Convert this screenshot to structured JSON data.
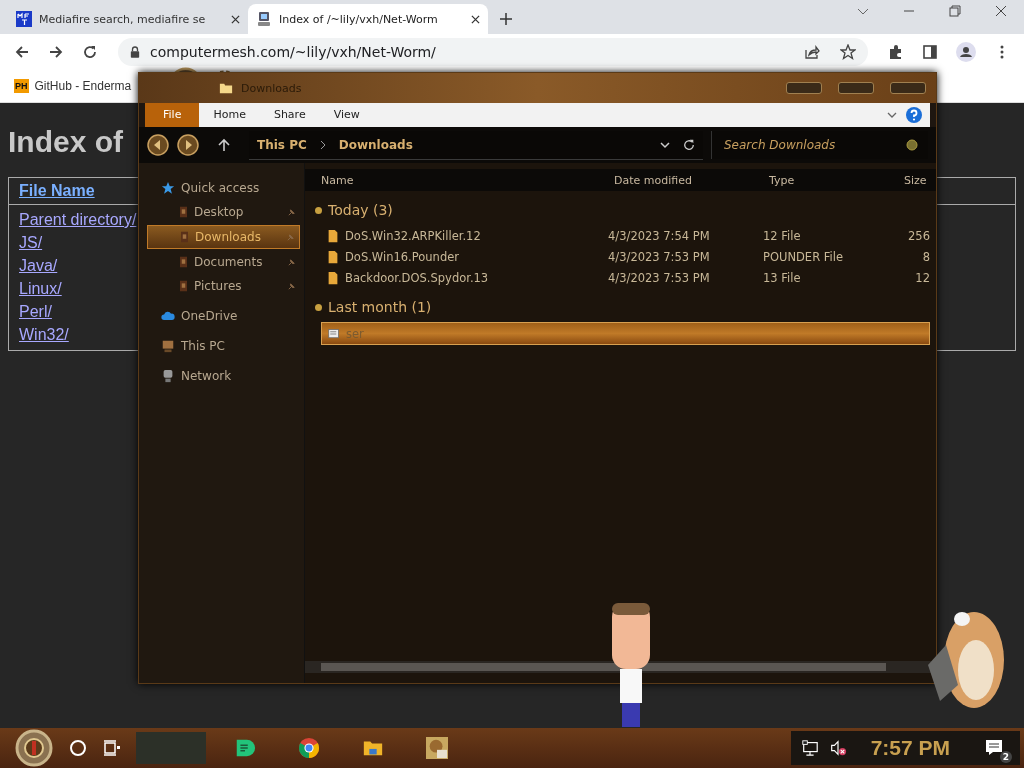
{
  "browser": {
    "tabs": [
      {
        "title": "Mediafire search, mediafire se",
        "kind": "letters",
        "selected": false
      },
      {
        "title": "Index of /~lily/vxh/Net-Worm",
        "kind": "computer",
        "selected": true
      }
    ],
    "url": "computermesh.com/~lily/vxh/Net-Worm/",
    "bookmarks": [
      {
        "badge": "PH",
        "label": "GitHub - Enderma"
      }
    ]
  },
  "page": {
    "heading": "Index of",
    "table": {
      "columns": [
        "File Name"
      ],
      "rows": [
        "Parent directory/",
        "JS/",
        "Java/",
        "Linux/",
        "Perl/",
        "Win32/"
      ]
    }
  },
  "explorer": {
    "title": "Downloads",
    "ribbon_tabs": [
      {
        "label": "File",
        "selected": true
      },
      {
        "label": "Home",
        "selected": false
      },
      {
        "label": "Share",
        "selected": false
      },
      {
        "label": "View",
        "selected": false
      }
    ],
    "breadcrumb": [
      "This PC",
      "Downloads"
    ],
    "search": {
      "placeholder": "Search Downloads"
    },
    "nav": [
      {
        "label": "Quick access",
        "kind": "star",
        "selected": false,
        "children": [
          {
            "label": "Desktop",
            "kind": "folder",
            "selected": false,
            "pinned": true
          },
          {
            "label": "Downloads",
            "kind": "folder",
            "selected": true,
            "pinned": true
          },
          {
            "label": "Documents",
            "kind": "folder",
            "selected": false,
            "pinned": true
          },
          {
            "label": "Pictures",
            "kind": "folder",
            "selected": false,
            "pinned": true
          }
        ]
      },
      {
        "label": "OneDrive",
        "kind": "cloud",
        "selected": false
      },
      {
        "label": "This PC",
        "kind": "pc",
        "selected": false
      },
      {
        "label": "Network",
        "kind": "network",
        "selected": false
      }
    ],
    "columns": [
      "Name",
      "Date modified",
      "Type",
      "Size"
    ],
    "groups": [
      {
        "label": "Today (3)",
        "files": [
          {
            "name": "DoS.Win32.ARPKiller.12",
            "date": "4/3/2023 7:54 PM",
            "type": "12 File",
            "size": "256",
            "selected": false
          },
          {
            "name": "DoS.Win16.Pounder",
            "date": "4/3/2023 7:53 PM",
            "type": "POUNDER File",
            "size": "8",
            "selected": false
          },
          {
            "name": "Backdoor.DOS.Spydor.13",
            "date": "4/3/2023 7:53 PM",
            "type": "13 File",
            "size": "12",
            "selected": false
          }
        ]
      },
      {
        "label": "Last month (1)",
        "files": [
          {
            "name": "ser",
            "selected": true
          }
        ]
      }
    ]
  },
  "taskbar": {
    "apps": [
      {
        "kind": "chat"
      },
      {
        "kind": "chrome"
      },
      {
        "kind": "folder"
      },
      {
        "kind": "picture"
      }
    ],
    "clock": "7:57 PM",
    "notifications": "2"
  }
}
